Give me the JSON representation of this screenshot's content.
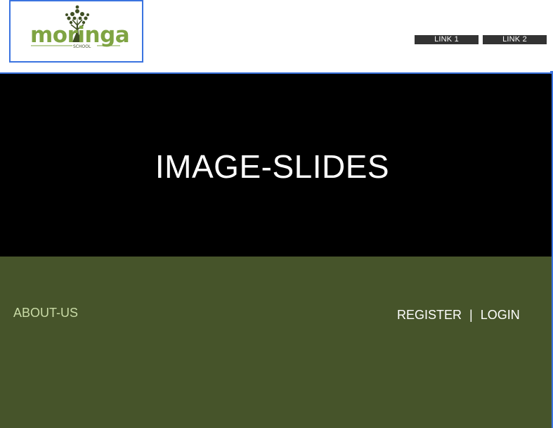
{
  "logo": {
    "wordmark": "moringa",
    "tagline": "SCHOOL"
  },
  "nav": {
    "links": [
      {
        "label": "LINK 1"
      },
      {
        "label": "LINK 2"
      }
    ]
  },
  "hero": {
    "title": "IMAGE-SLIDES"
  },
  "footer": {
    "about_label": "ABOUT-US",
    "register_label": "REGISTER",
    "separator": "|",
    "login_label": "LOGIN"
  },
  "colors": {
    "accent_blue": "#3a73e0",
    "brand_green": "#7fa443",
    "footer_green": "#46542a",
    "hero_black": "#000000",
    "nav_dark": "#333333",
    "about_text": "#c9dba6"
  }
}
